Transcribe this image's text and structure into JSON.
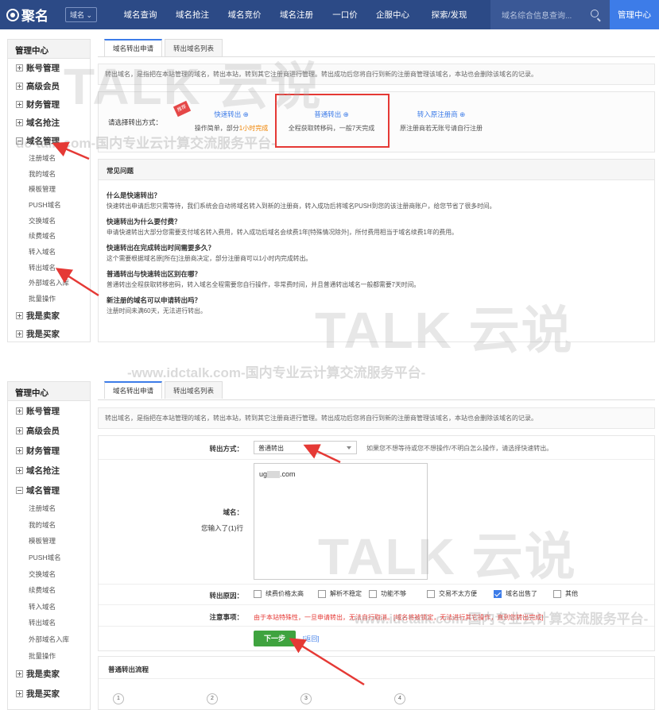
{
  "nav": {
    "logo": "聚名",
    "domain_pill": "域名 ⌄",
    "items": [
      "域名查询",
      "域名抢注",
      "域名竞价",
      "域名注册",
      "一口价",
      "企服中心",
      "探索/发现"
    ],
    "search_placeholder": "域名综合信息查询...",
    "mgmt": "管理中心"
  },
  "sidebar": {
    "title": "管理中心",
    "groups_top": [
      "账号管理",
      "高级会员",
      "财务管理",
      "域名抢注",
      "域名管理"
    ],
    "subs": [
      "注册域名",
      "我的域名",
      "模板管理",
      "PUSH域名",
      "交换域名",
      "续费域名",
      "转入域名",
      "转出域名",
      "外部域名入库",
      "批量操作"
    ],
    "groups_bottom": [
      "我是卖家",
      "我是买家"
    ]
  },
  "tabs": [
    "域名转出申请",
    "转出域名列表"
  ],
  "notice": "转出域名，是指把在本站管理的域名，转出本站，转到其它注册商进行管理。转出成功后您将自行到新的注册商管理该域名，本站也会删除该域名的记录。",
  "panel1": {
    "method_label": "请选择转出方式：",
    "corner": "推荐",
    "options": [
      {
        "title": "快速转出 ⊕",
        "desc_a": "操作简单，部分",
        "desc_hl": "1小时完成",
        "desc_b": ""
      },
      {
        "title": "普通转出 ⊕",
        "desc_a": "全程获取转移码，一般7天完成",
        "desc_hl": "",
        "desc_b": ""
      },
      {
        "title": "转入原注册商 ⊕",
        "desc_a": "原注册商若无账号请自行注册",
        "desc_hl": "",
        "desc_b": ""
      }
    ],
    "faq_title": "常见问题",
    "faq": [
      {
        "q": "什么是快速转出？",
        "a": "快速转出申请后您只需等待，我们系统会自动将域名转入到新的注册商，转入成功后将域名PUSH到您的该注册商账户，给您节省了很多时间。"
      },
      {
        "q": "快速转出为什么要付费？",
        "a": "申请快速转出大部分您需要支付域名转入费用，转入成功后域名会续费1年[特殊情况除外]，所付费用相当于域名续费1年的费用。"
      },
      {
        "q": "快速转出在完成转出时间需要多久？",
        "a": "这个需要根据域名原[所在]注册商决定，部分注册商可以1小时内完成转出。"
      },
      {
        "q": "普通转出与快速转出区别在哪？",
        "a": "普通转出全程获取转移密码，转入域名全程需要您自行操作，非常费时间，并且普通转出域名一般都需要7天时间。"
      },
      {
        "q": "新注册的域名可以申请转出吗？",
        "a": "注册时间未满60天，无法进行转出。"
      }
    ]
  },
  "panel2": {
    "method_label": "转出方式：",
    "method_value": "普通转出",
    "method_hint": "如果您不想等待或您不想操作/不明白怎么操作，请选择快速转出。",
    "domain_label": "域名：",
    "domain_count": "您输入了(1)行",
    "domain_prefix": "ug",
    "domain_suffix": ".com",
    "reason_label": "转出原因：",
    "reasons": [
      {
        "label": "续费价格太高",
        "checked": false
      },
      {
        "label": "解析不稳定",
        "checked": false
      },
      {
        "label": "功能不够",
        "checked": false
      },
      {
        "label": "交易不太方便",
        "checked": false
      },
      {
        "label": "域名出售了",
        "checked": true
      },
      {
        "label": "其他",
        "checked": false
      }
    ],
    "notes_label": "注意事项：",
    "notes": "由于本站特殊性，一旦申请转出，无法自行取消。[域名将被锁定，无法进行其它操作，直到您转出完成]",
    "next_button": "下一步",
    "back_link": "[返回]",
    "flow_title": "普通转出流程",
    "steps": [
      "1",
      "2",
      "3",
      "4"
    ]
  },
  "watermarks": {
    "brand": "TALK 云说",
    "url_line": "dc-talk.com-国内专业云计算交流服务平台-",
    "url_line2": "-www.idctalk.com-国内专业云计算交流服务平台-"
  }
}
